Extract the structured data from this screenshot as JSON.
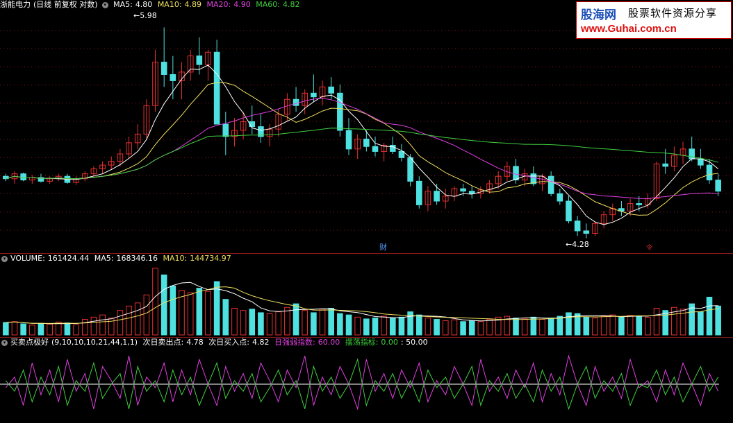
{
  "header": {
    "stock_name": "浙能电力",
    "chart_mode": "(日线 前复权 对数)",
    "ma5_label": "MA5:",
    "ma5_value": "4.80",
    "ma10_label": "MA10:",
    "ma10_value": "4.89",
    "ma20_label": "MA20:",
    "ma20_value": "4.90",
    "ma60_label": "MA60:",
    "ma60_value": "4.82",
    "collapse_icon": "circle-chevron-icon"
  },
  "watermark": {
    "logo_text": "股海网",
    "slogan": "股票软件资源分享",
    "url": "www.Guhai.com.cn"
  },
  "price_annotations": {
    "high_label": "5.98",
    "low_label": "4.28",
    "event_cai": "财",
    "event_bottom": "令"
  },
  "volume_header": {
    "label": "VOLUME:",
    "value": "161424.44",
    "ma5_label": "MA5:",
    "ma5_value": "168346.16",
    "ma10_label": "MA10:",
    "ma10_value": "144734.97"
  },
  "osc_header": {
    "name": "买卖点极好",
    "params": "(9,10,10,10,21,44,1,1)",
    "sell_label": "次日卖出点:",
    "sell_value": "4.78",
    "buy_label": "次日买入点:",
    "buy_value": "4.82",
    "strength_label": "日强弱指数:",
    "strength_value": "60.00",
    "swing_label": "摆荡指标:",
    "swing_value": "0.00",
    "mid_value": ": 50.00"
  },
  "colors": {
    "up": "#e83030",
    "down": "#4fe0e0",
    "ma5": "#ffffff",
    "ma10": "#f0e060",
    "ma20": "#e040e0",
    "ma60": "#40d040",
    "grid": "#8b1a1a",
    "osc_magenta": "#e040e0",
    "osc_green": "#40d040"
  },
  "chart_data": {
    "type": "candlestick",
    "price_range": [
      4.2,
      6.1
    ],
    "ohlc": [
      [
        4.78,
        4.8,
        4.74,
        4.76
      ],
      [
        4.76,
        4.82,
        4.72,
        4.8
      ],
      [
        4.8,
        4.81,
        4.74,
        4.75
      ],
      [
        4.75,
        4.79,
        4.72,
        4.77
      ],
      [
        4.77,
        4.8,
        4.73,
        4.74
      ],
      [
        4.74,
        4.78,
        4.72,
        4.76
      ],
      [
        4.76,
        4.8,
        4.74,
        4.78
      ],
      [
        4.78,
        4.8,
        4.72,
        4.73
      ],
      [
        4.73,
        4.78,
        4.71,
        4.76
      ],
      [
        4.76,
        4.82,
        4.74,
        4.8
      ],
      [
        4.8,
        4.86,
        4.78,
        4.84
      ],
      [
        4.84,
        4.9,
        4.8,
        4.87
      ],
      [
        4.87,
        4.94,
        4.84,
        4.9
      ],
      [
        4.9,
        5.0,
        4.86,
        4.96
      ],
      [
        4.96,
        5.1,
        4.92,
        5.05
      ],
      [
        5.05,
        5.2,
        5.0,
        5.12
      ],
      [
        5.12,
        5.4,
        5.08,
        5.35
      ],
      [
        5.35,
        5.8,
        5.3,
        5.7
      ],
      [
        5.7,
        5.98,
        5.5,
        5.6
      ],
      [
        5.6,
        5.75,
        5.4,
        5.55
      ],
      [
        5.55,
        5.7,
        5.4,
        5.62
      ],
      [
        5.62,
        5.8,
        5.55,
        5.75
      ],
      [
        5.75,
        5.9,
        5.6,
        5.68
      ],
      [
        5.68,
        5.8,
        5.55,
        5.78
      ],
      [
        5.78,
        5.88,
        5.6,
        5.2
      ],
      [
        5.2,
        5.3,
        4.95,
        5.1
      ],
      [
        5.1,
        5.25,
        5.02,
        5.15
      ],
      [
        5.15,
        5.3,
        5.08,
        5.22
      ],
      [
        5.22,
        5.35,
        5.12,
        5.18
      ],
      [
        5.18,
        5.28,
        5.05,
        5.1
      ],
      [
        5.1,
        5.2,
        5.02,
        5.16
      ],
      [
        5.16,
        5.32,
        5.1,
        5.28
      ],
      [
        5.28,
        5.45,
        5.22,
        5.4
      ],
      [
        5.4,
        5.5,
        5.3,
        5.35
      ],
      [
        5.35,
        5.48,
        5.28,
        5.45
      ],
      [
        5.45,
        5.6,
        5.38,
        5.42
      ],
      [
        5.42,
        5.55,
        5.35,
        5.5
      ],
      [
        5.5,
        5.58,
        5.4,
        5.45
      ],
      [
        5.45,
        5.52,
        5.1,
        5.15
      ],
      [
        5.15,
        5.25,
        4.95,
        5.0
      ],
      [
        5.0,
        5.12,
        4.92,
        5.08
      ],
      [
        5.08,
        5.15,
        4.98,
        5.02
      ],
      [
        5.02,
        5.1,
        4.94,
        4.98
      ],
      [
        4.98,
        5.05,
        4.9,
        5.03
      ],
      [
        5.03,
        5.1,
        4.96,
        4.98
      ],
      [
        4.98,
        5.04,
        4.9,
        4.93
      ],
      [
        4.93,
        4.96,
        4.7,
        4.74
      ],
      [
        4.74,
        4.78,
        4.52,
        4.55
      ],
      [
        4.55,
        4.7,
        4.5,
        4.66
      ],
      [
        4.66,
        4.72,
        4.55,
        4.58
      ],
      [
        4.58,
        4.68,
        4.52,
        4.62
      ],
      [
        4.62,
        4.7,
        4.58,
        4.68
      ],
      [
        4.68,
        4.72,
        4.62,
        4.66
      ],
      [
        4.66,
        4.7,
        4.6,
        4.64
      ],
      [
        4.64,
        4.7,
        4.6,
        4.67
      ],
      [
        4.67,
        4.75,
        4.64,
        4.72
      ],
      [
        4.72,
        4.82,
        4.68,
        4.78
      ],
      [
        4.78,
        4.9,
        4.74,
        4.86
      ],
      [
        4.86,
        4.92,
        4.72,
        4.75
      ],
      [
        4.75,
        4.84,
        4.7,
        4.8
      ],
      [
        4.8,
        4.86,
        4.7,
        4.72
      ],
      [
        4.72,
        4.8,
        4.66,
        4.78
      ],
      [
        4.78,
        4.82,
        4.62,
        4.64
      ],
      [
        4.64,
        4.68,
        4.55,
        4.58
      ],
      [
        4.58,
        4.62,
        4.4,
        4.42
      ],
      [
        4.42,
        4.46,
        4.3,
        4.34
      ],
      [
        4.34,
        4.4,
        4.28,
        4.32
      ],
      [
        4.32,
        4.42,
        4.3,
        4.4
      ],
      [
        4.4,
        4.5,
        4.36,
        4.47
      ],
      [
        4.47,
        4.56,
        4.42,
        4.52
      ],
      [
        4.52,
        4.58,
        4.46,
        4.5
      ],
      [
        4.5,
        4.6,
        4.46,
        4.56
      ],
      [
        4.56,
        4.62,
        4.5,
        4.55
      ],
      [
        4.55,
        4.64,
        4.52,
        4.6
      ],
      [
        4.6,
        4.9,
        4.58,
        4.88
      ],
      [
        4.88,
        5.0,
        4.8,
        4.86
      ],
      [
        4.86,
        5.02,
        4.82,
        4.95
      ],
      [
        4.95,
        5.06,
        4.88,
        5.0
      ],
      [
        5.0,
        5.1,
        4.9,
        4.92
      ],
      [
        4.92,
        5.0,
        4.84,
        4.87
      ],
      [
        4.87,
        4.92,
        4.72,
        4.75
      ],
      [
        4.75,
        4.8,
        4.62,
        4.66
      ]
    ],
    "volume": [
      28,
      30,
      25,
      22,
      26,
      24,
      29,
      27,
      23,
      35,
      40,
      45,
      38,
      55,
      65,
      72,
      90,
      150,
      135,
      110,
      100,
      95,
      105,
      98,
      120,
      80,
      60,
      55,
      58,
      50,
      48,
      52,
      62,
      70,
      55,
      50,
      58,
      60,
      48,
      45,
      40,
      36,
      38,
      42,
      38,
      40,
      52,
      45,
      38,
      35,
      32,
      34,
      30,
      32,
      30,
      35,
      40,
      42,
      38,
      36,
      40,
      35,
      38,
      42,
      50,
      48,
      40,
      38,
      42,
      45,
      40,
      44,
      42,
      40,
      60,
      55,
      62,
      58,
      70,
      52,
      85,
      65
    ],
    "series_osc": [
      "magenta",
      "green"
    ],
    "osc_magenta": [
      45,
      60,
      20,
      80,
      35,
      70,
      25,
      85,
      40,
      65,
      15,
      75,
      55,
      30,
      90,
      20,
      60,
      45,
      80,
      25,
      70,
      35,
      85,
      50,
      20,
      75,
      40,
      65,
      30,
      80,
      55,
      25,
      70,
      45,
      90,
      20,
      60,
      35,
      75,
      50,
      15,
      85,
      40,
      65,
      30,
      70,
      45,
      80,
      25,
      55,
      35,
      75,
      50,
      20,
      85,
      40,
      60,
      30,
      70,
      45,
      80,
      25,
      65,
      35,
      90,
      50,
      20,
      75,
      40,
      60,
      30,
      85,
      45,
      55,
      25,
      70,
      35,
      80,
      50,
      20,
      65,
      40
    ],
    "osc_green": [
      55,
      40,
      70,
      25,
      60,
      35,
      75,
      20,
      55,
      40,
      80,
      30,
      50,
      65,
      15,
      75,
      40,
      55,
      25,
      70,
      35,
      60,
      20,
      50,
      80,
      30,
      55,
      40,
      65,
      25,
      45,
      70,
      35,
      55,
      15,
      75,
      40,
      60,
      30,
      50,
      85,
      20,
      55,
      40,
      65,
      30,
      55,
      25,
      70,
      45,
      60,
      30,
      50,
      75,
      20,
      55,
      40,
      65,
      30,
      50,
      25,
      70,
      40,
      60,
      15,
      50,
      75,
      30,
      55,
      40,
      65,
      20,
      50,
      45,
      70,
      35,
      60,
      25,
      50,
      75,
      40,
      60
    ],
    "osc_mid": 50,
    "osc_range": [
      0,
      100
    ]
  }
}
